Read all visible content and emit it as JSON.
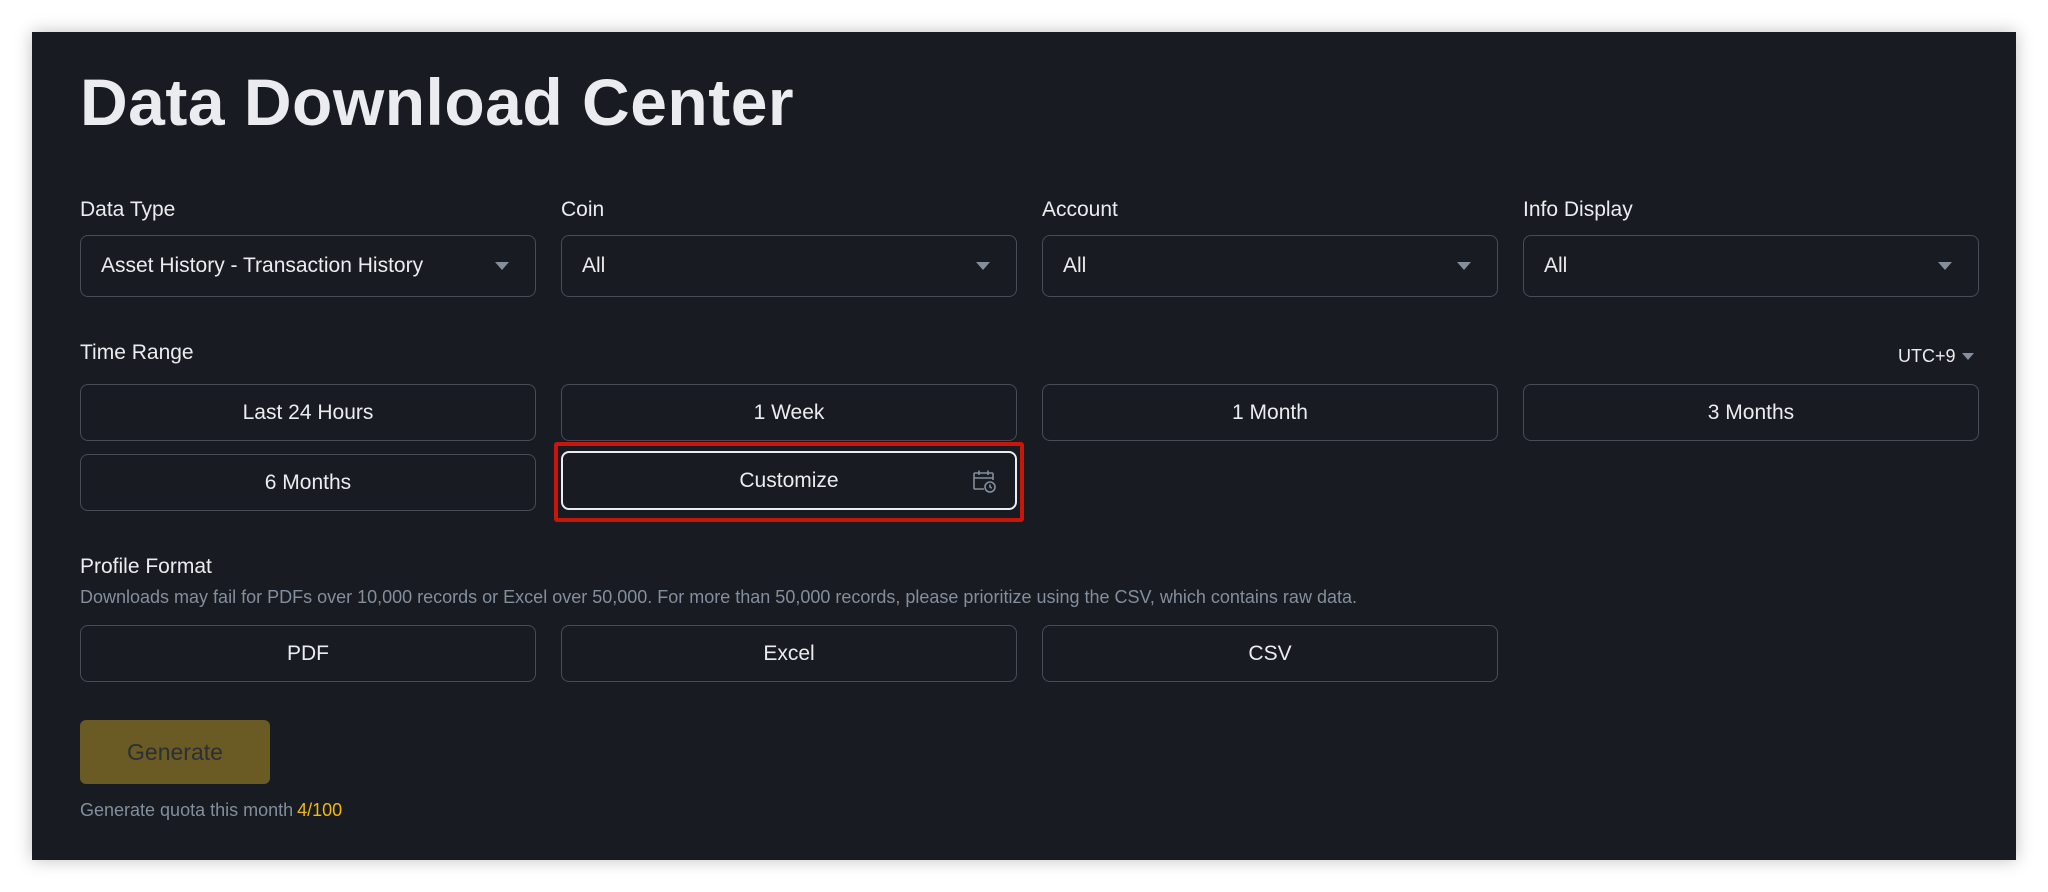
{
  "title": "Data Download Center",
  "filters": {
    "data_type": {
      "label": "Data Type",
      "value": "Asset History - Transaction History"
    },
    "coin": {
      "label": "Coin",
      "value": "All"
    },
    "account": {
      "label": "Account",
      "value": "All"
    },
    "info_display": {
      "label": "Info Display",
      "value": "All"
    }
  },
  "time_range": {
    "label": "Time Range",
    "timezone": "UTC+9",
    "options": [
      "Last 24 Hours",
      "1 Week",
      "1 Month",
      "3 Months",
      "6 Months",
      "Customize"
    ]
  },
  "profile_format": {
    "label": "Profile Format",
    "hint": "Downloads may fail for PDFs over 10,000 records or Excel over 50,000. For more than 50,000 records, please prioritize using the CSV, which contains raw data.",
    "options": [
      "PDF",
      "Excel",
      "CSV"
    ]
  },
  "generate": {
    "label": "Generate",
    "quota_label": "Generate quota this month",
    "quota_count": "4/100"
  },
  "colors": {
    "background": "#181b21",
    "accent": "#f0b90b",
    "highlight": "#c8160c"
  },
  "icons": {
    "customize": "calendar-clock-icon",
    "dropdown": "caret-down-icon"
  }
}
